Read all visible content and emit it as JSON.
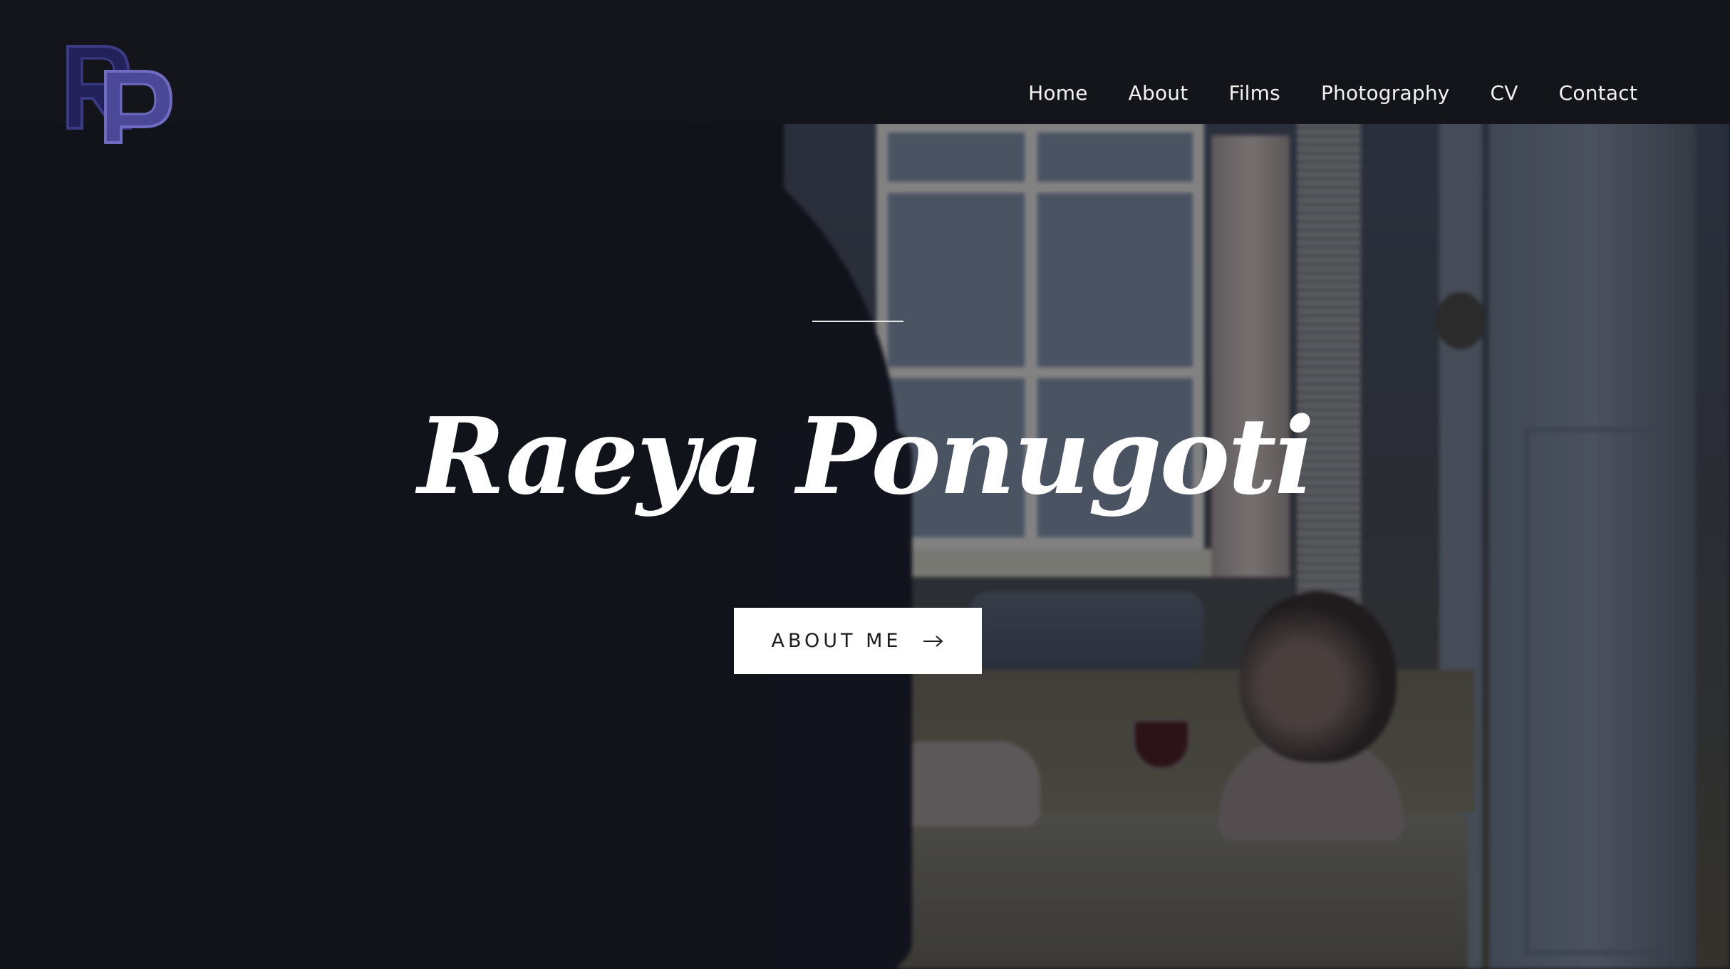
{
  "brand": {
    "logo_icon": "rp-monogram-logo",
    "logo_text": "RP",
    "colors": {
      "logo_dark": "#2b2a6b",
      "logo_light": "#5a57a6"
    }
  },
  "nav": {
    "items": [
      {
        "label": "Home"
      },
      {
        "label": "About"
      },
      {
        "label": "Films"
      },
      {
        "label": "Photography"
      },
      {
        "label": "CV"
      },
      {
        "label": "Contact"
      }
    ]
  },
  "hero": {
    "title": "Raeya Ponugoti",
    "cta_label": "ABOUT ME",
    "cta_icon": "arrow-right-icon"
  },
  "colors": {
    "background": "#13151b",
    "text": "#ffffff",
    "button_bg": "#ffffff",
    "button_text": "#1a1c22"
  }
}
